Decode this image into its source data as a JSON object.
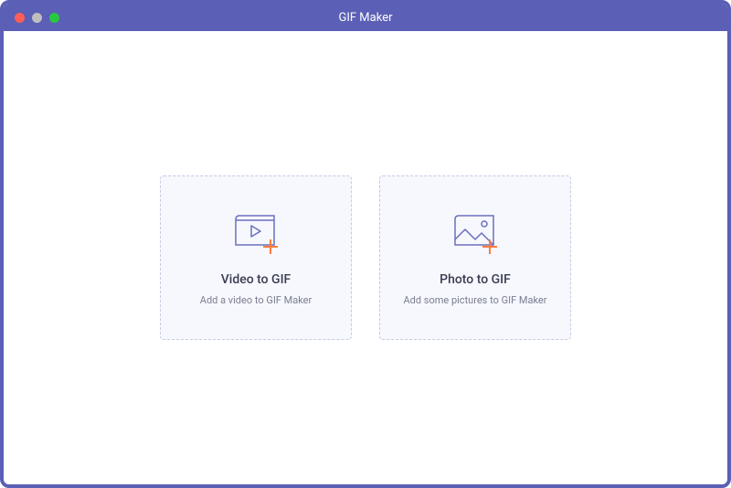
{
  "window": {
    "title": "GIF Maker"
  },
  "cards": {
    "video": {
      "title": "Video to GIF",
      "subtitle": "Add a video to GIF Maker"
    },
    "photo": {
      "title": "Photo to GIF",
      "subtitle": "Add some pictures to GIF Maker"
    }
  },
  "colors": {
    "accent": "#5b5fb5",
    "icon_stroke": "#6b6fbf",
    "plus": "#ff7a3d"
  }
}
